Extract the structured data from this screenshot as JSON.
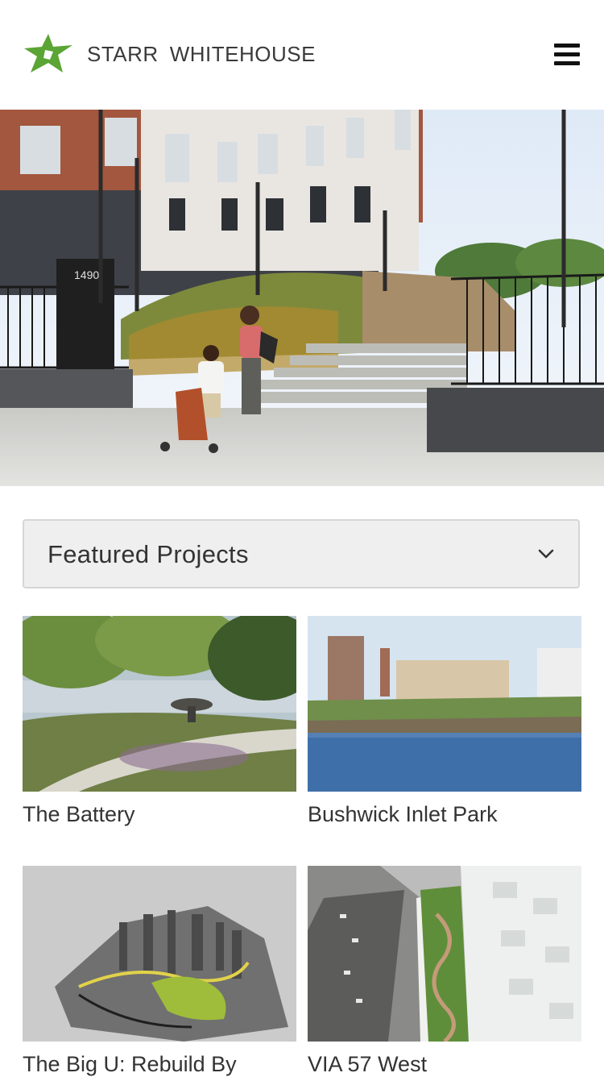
{
  "brand": {
    "name_part1": "STARR",
    "name_part2": "WHITEHOUSE",
    "accent_color": "#5aa534"
  },
  "header": {
    "menu_icon": "hamburger-menu-icon"
  },
  "hero": {
    "building_number": "1490"
  },
  "filter": {
    "selected": "Featured Projects",
    "icon": "chevron-down-icon"
  },
  "projects": [
    {
      "title": "The Battery"
    },
    {
      "title": "Bushwick Inlet Park"
    },
    {
      "title": "The Big U: Rebuild By"
    },
    {
      "title": "VIA 57 West"
    }
  ]
}
